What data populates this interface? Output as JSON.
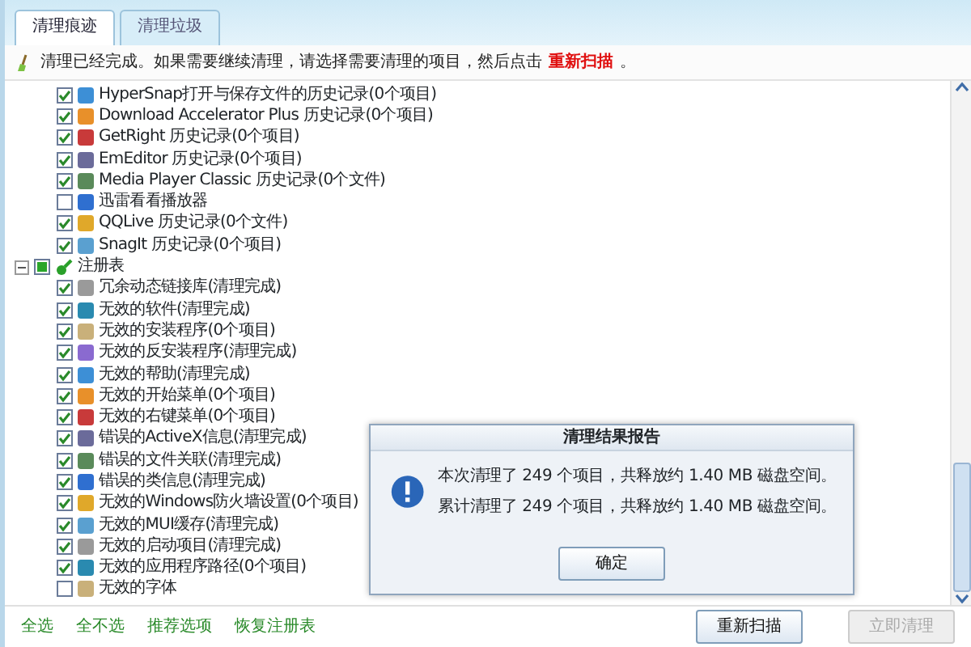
{
  "tabs": [
    {
      "label": "清理痕迹",
      "selected": true
    },
    {
      "label": "清理垃圾",
      "selected": false
    }
  ],
  "notice": {
    "text": "清理已经完成。如果需要继续清理，请选择需要清理的项目，然后点击",
    "link": "重新扫描",
    "end": "。"
  },
  "tree": [
    {
      "kind": "item",
      "label": "HyperSnap打开与保存文件的历史记录(0个项目)",
      "checked": true
    },
    {
      "kind": "item",
      "label": "Download Accelerator Plus 历史记录(0个项目)",
      "checked": true
    },
    {
      "kind": "item",
      "label": "GetRight 历史记录(0个项目)",
      "checked": true
    },
    {
      "kind": "item",
      "label": "EmEditor 历史记录(0个项目)",
      "checked": true
    },
    {
      "kind": "item",
      "label": "Media Player Classic 历史记录(0个文件)",
      "checked": true
    },
    {
      "kind": "item",
      "label": "迅雷看看播放器",
      "checked": false
    },
    {
      "kind": "item",
      "label": "QQLive 历史记录(0个文件)",
      "checked": true
    },
    {
      "kind": "item",
      "label": "SnagIt 历史记录(0个项目)",
      "checked": true
    },
    {
      "kind": "group",
      "label": "注册表",
      "expanded": true,
      "partial": true,
      "children": [
        {
          "label": "冗余动态链接库(清理完成)",
          "checked": true
        },
        {
          "label": "无效的软件(清理完成)",
          "checked": true
        },
        {
          "label": "无效的安装程序(0个项目)",
          "checked": true
        },
        {
          "label": "无效的反安装程序(清理完成)",
          "checked": true
        },
        {
          "label": "无效的帮助(清理完成)",
          "checked": true
        },
        {
          "label": "无效的开始菜单(0个项目)",
          "checked": true
        },
        {
          "label": "无效的右键菜单(0个项目)",
          "checked": true
        },
        {
          "label": "错误的ActiveX信息(清理完成)",
          "checked": true
        },
        {
          "label": "错误的文件关联(清理完成)",
          "checked": true
        },
        {
          "label": "错误的类信息(清理完成)",
          "checked": true
        },
        {
          "label": "无效的Windows防火墙设置(0个项目)",
          "checked": true
        },
        {
          "label": "无效的MUI缓存(清理完成)",
          "checked": true
        },
        {
          "label": "无效的启动项目(清理完成)",
          "checked": true
        },
        {
          "label": "无效的应用程序路径(0个项目)",
          "checked": true
        },
        {
          "label": "无效的字体",
          "checked": false
        }
      ]
    }
  ],
  "footer_links": [
    "全选",
    "全不选",
    "推荐选项",
    "恢复注册表"
  ],
  "buttons": [
    {
      "label": "重新扫描",
      "disabled": false
    },
    {
      "label": "立即清理",
      "disabled": true
    }
  ],
  "dialog": {
    "title": "清理结果报告",
    "lines": [
      "本次清理了 249 个项目，共释放约 1.40 MB 磁盘空间。",
      "累计清理了 249 个项目，共释放约 1.40 MB 磁盘空间。"
    ],
    "button": "确定"
  }
}
